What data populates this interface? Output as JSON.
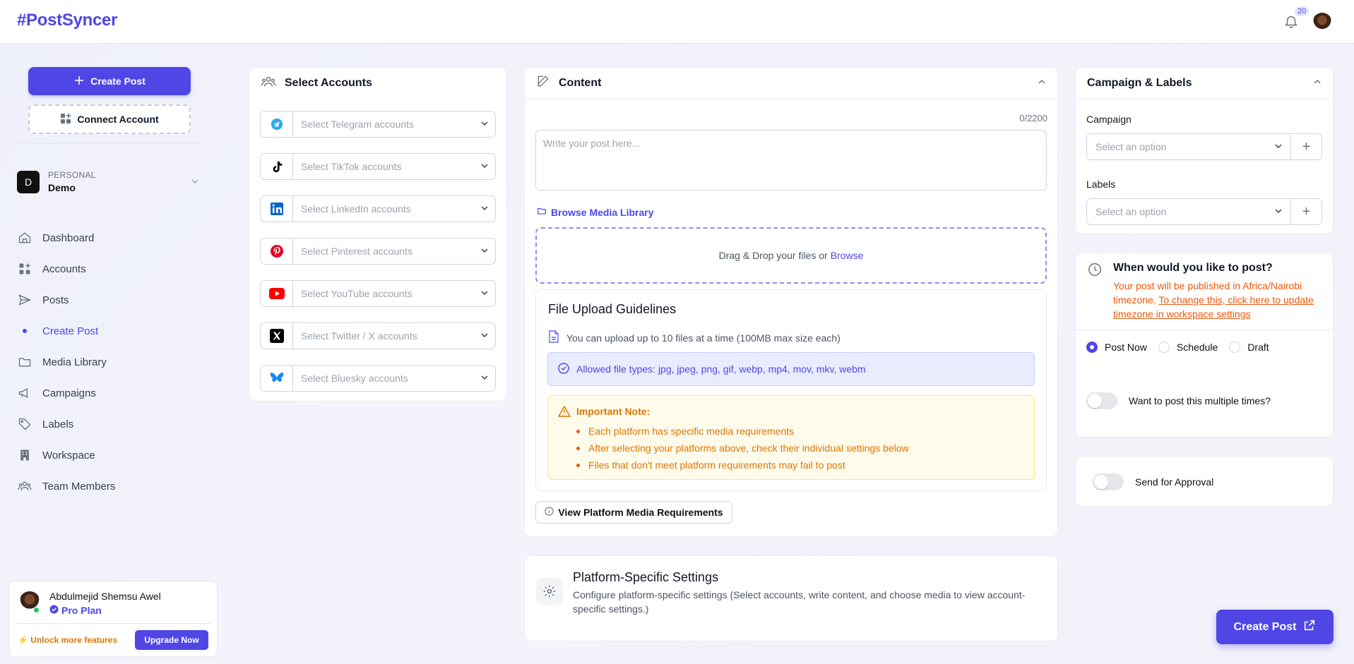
{
  "app": {
    "logo": "#PostSyncer",
    "notifications_count": "20"
  },
  "sidebar": {
    "create_post": "Create Post",
    "connect_account": "Connect Account",
    "workspace": {
      "initial": "D",
      "type": "PERSONAL",
      "name": "Demo"
    },
    "nav": [
      {
        "label": "Dashboard",
        "icon": "home-icon"
      },
      {
        "label": "Accounts",
        "icon": "grid-plus-icon"
      },
      {
        "label": "Posts",
        "icon": "send-icon"
      },
      {
        "label": "Create Post",
        "icon": "dot-icon",
        "active": true
      },
      {
        "label": "Media Library",
        "icon": "folder-icon"
      },
      {
        "label": "Campaigns",
        "icon": "megaphone-icon"
      },
      {
        "label": "Labels",
        "icon": "tag-icon"
      },
      {
        "label": "Workspace",
        "icon": "building-icon"
      },
      {
        "label": "Team Members",
        "icon": "users-icon"
      }
    ],
    "user": {
      "name": "Abdulmejid Shemsu Awel",
      "plan": "Pro Plan",
      "unlock": "Unlock more features",
      "upgrade": "Upgrade Now"
    }
  },
  "accounts": {
    "title": "Select Accounts",
    "rows": [
      {
        "platform": "Telegram",
        "placeholder": "Select Telegram accounts",
        "color": "#2AABEE"
      },
      {
        "platform": "TikTok",
        "placeholder": "Select TikTok accounts",
        "color": "#000000"
      },
      {
        "platform": "LinkedIn",
        "placeholder": "Select LinkedIn accounts",
        "color": "#0A66C2"
      },
      {
        "platform": "Pinterest",
        "placeholder": "Select Pinterest accounts",
        "color": "#E60023"
      },
      {
        "platform": "YouTube",
        "placeholder": "Select YouTube accounts",
        "color": "#FF0000"
      },
      {
        "platform": "Twitter / X",
        "placeholder": "Select Twitter / X accounts",
        "color": "#000000"
      },
      {
        "platform": "Bluesky",
        "placeholder": "Select Bluesky accounts",
        "color": "#1185FE"
      }
    ]
  },
  "content": {
    "title": "Content",
    "counter": "0/2200",
    "placeholder": "Write your post here...",
    "browse_library": "Browse Media Library",
    "drop_text": "Drag & Drop your files or",
    "drop_link": "Browse",
    "guidelines": {
      "title": "File Upload Guidelines",
      "limit": "You can upload up to 10 files at a time (100MB max size each)",
      "allowed": "Allowed file types: jpg, jpeg, png, gif, webp, mp4, mov, mkv, webm",
      "note_title": "Important Note:",
      "notes": [
        "Each platform has specific media requirements",
        "After selecting your platforms above, check their individual settings below",
        "Files that don't meet platform requirements may fail to post"
      ]
    },
    "view_requirements": "View Platform Media Requirements"
  },
  "platform_settings": {
    "title": "Platform-Specific Settings",
    "desc": "Configure platform-specific settings (Select accounts, write content, and choose media to view account-specific settings.)"
  },
  "campaign": {
    "title": "Campaign & Labels",
    "campaign_label": "Campaign",
    "campaign_placeholder": "Select an option",
    "labels_label": "Labels",
    "labels_placeholder": "Select an option"
  },
  "schedule": {
    "title": "When would you like to post?",
    "desc": "Your post will be published in Africa/Nairobi timezone.",
    "link": "To change this, click here to update timezone in workspace settings",
    "options": [
      "Post Now",
      "Schedule",
      "Draft"
    ],
    "selected": "Post Now",
    "multiple": "Want to post this multiple times?"
  },
  "approval": {
    "label": "Send for Approval"
  },
  "fab": {
    "label": "Create Post"
  },
  "colors": {
    "accent": "#4f46e5",
    "warning": "#d97706"
  }
}
